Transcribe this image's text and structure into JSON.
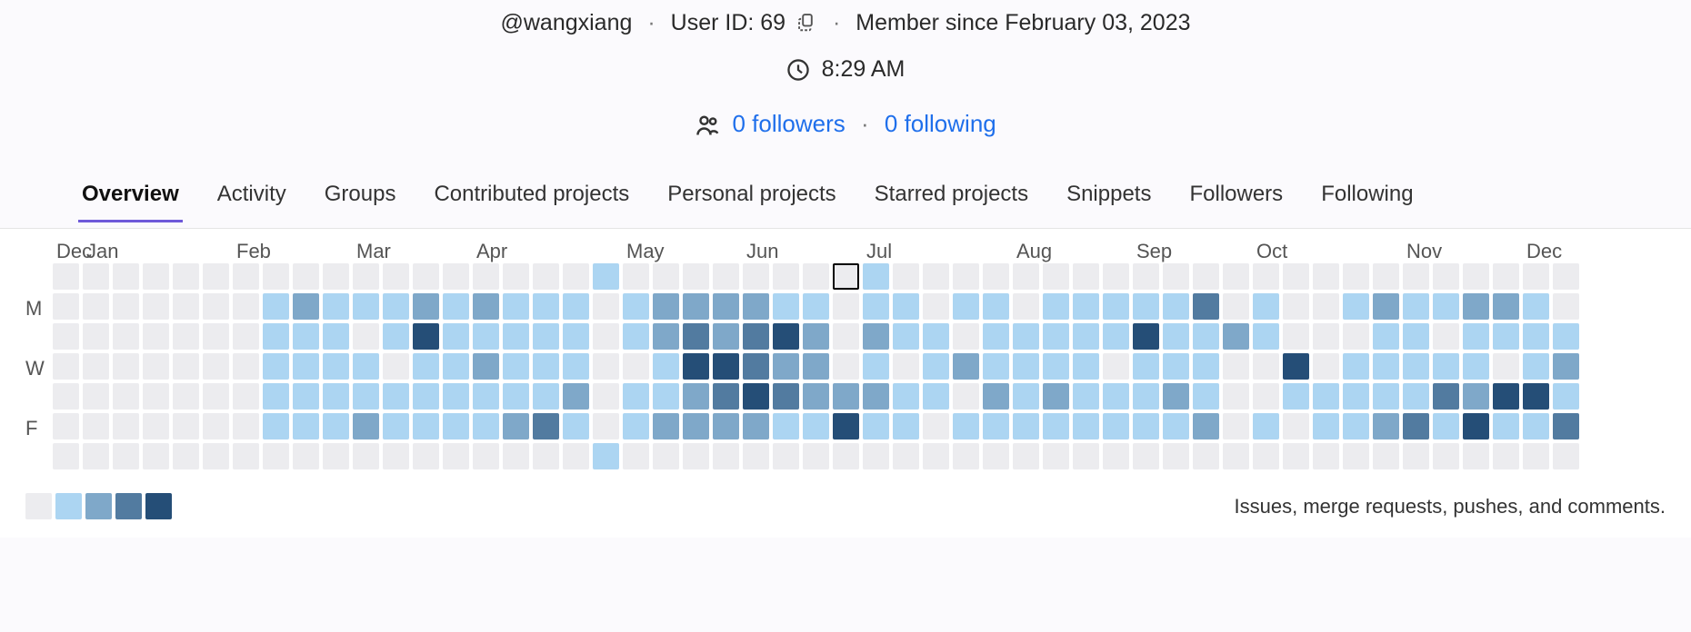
{
  "profile": {
    "handle": "@wangxiang",
    "user_id_label": "User ID: 69",
    "member_since": "Member since February 03, 2023",
    "local_time": "8:29 AM",
    "followers_label": "0 followers",
    "following_label": "0 following"
  },
  "tabs": [
    {
      "label": "Overview",
      "active": true
    },
    {
      "label": "Activity",
      "active": false
    },
    {
      "label": "Groups",
      "active": false
    },
    {
      "label": "Contributed projects",
      "active": false
    },
    {
      "label": "Personal projects",
      "active": false
    },
    {
      "label": "Starred projects",
      "active": false
    },
    {
      "label": "Snippets",
      "active": false
    },
    {
      "label": "Followers",
      "active": false
    },
    {
      "label": "Following",
      "active": false
    }
  ],
  "calendar": {
    "months": [
      {
        "label": "Dec",
        "span": 1
      },
      {
        "label": "Jan",
        "span": 5
      },
      {
        "label": "Feb",
        "span": 4
      },
      {
        "label": "Mar",
        "span": 4
      },
      {
        "label": "Apr",
        "span": 5
      },
      {
        "label": "May",
        "span": 4
      },
      {
        "label": "Jun",
        "span": 4
      },
      {
        "label": "Jul",
        "span": 5
      },
      {
        "label": "Aug",
        "span": 4
      },
      {
        "label": "Sep",
        "span": 4
      },
      {
        "label": "Oct",
        "span": 5
      },
      {
        "label": "Nov",
        "span": 4
      },
      {
        "label": "Dec",
        "span": 4
      }
    ],
    "day_labels": [
      "",
      "M",
      "",
      "W",
      "",
      "F",
      ""
    ],
    "legend_levels": [
      0,
      1,
      2,
      3,
      4
    ],
    "footnote": "Issues, merge requests, pushes, and comments.",
    "highlight": {
      "week": 26,
      "day": 0
    },
    "weeks": [
      [
        0,
        0,
        0,
        0,
        0,
        0,
        0
      ],
      [
        0,
        0,
        0,
        0,
        0,
        0,
        0
      ],
      [
        0,
        0,
        0,
        0,
        0,
        0,
        0
      ],
      [
        0,
        0,
        0,
        0,
        0,
        0,
        0
      ],
      [
        0,
        0,
        0,
        0,
        0,
        0,
        0
      ],
      [
        0,
        0,
        0,
        0,
        0,
        0,
        0
      ],
      [
        0,
        0,
        0,
        0,
        0,
        0,
        0
      ],
      [
        0,
        1,
        1,
        1,
        1,
        1,
        0
      ],
      [
        0,
        2,
        1,
        1,
        1,
        1,
        0
      ],
      [
        0,
        1,
        1,
        1,
        1,
        1,
        0
      ],
      [
        0,
        1,
        0,
        1,
        1,
        2,
        0
      ],
      [
        0,
        1,
        1,
        0,
        1,
        1,
        0
      ],
      [
        0,
        2,
        4,
        1,
        1,
        1,
        0
      ],
      [
        0,
        1,
        1,
        1,
        1,
        1,
        0
      ],
      [
        0,
        2,
        1,
        2,
        1,
        1,
        0
      ],
      [
        0,
        1,
        1,
        1,
        1,
        2,
        0
      ],
      [
        0,
        1,
        1,
        1,
        1,
        3,
        0
      ],
      [
        0,
        1,
        1,
        1,
        2,
        1,
        0
      ],
      [
        1,
        0,
        0,
        0,
        0,
        0,
        1
      ],
      [
        0,
        1,
        1,
        0,
        1,
        1,
        0
      ],
      [
        0,
        2,
        2,
        1,
        1,
        2,
        0
      ],
      [
        0,
        2,
        3,
        4,
        2,
        2,
        0
      ],
      [
        0,
        2,
        2,
        4,
        3,
        2,
        0
      ],
      [
        0,
        2,
        3,
        3,
        4,
        2,
        0
      ],
      [
        0,
        1,
        4,
        2,
        3,
        1,
        0
      ],
      [
        0,
        1,
        2,
        2,
        2,
        1,
        0
      ],
      [
        0,
        0,
        0,
        0,
        2,
        4,
        0
      ],
      [
        1,
        1,
        2,
        1,
        2,
        1,
        0
      ],
      [
        0,
        1,
        1,
        0,
        1,
        1,
        0
      ],
      [
        0,
        0,
        1,
        1,
        1,
        0,
        0
      ],
      [
        0,
        1,
        0,
        2,
        0,
        1,
        0
      ],
      [
        0,
        1,
        1,
        1,
        2,
        1,
        0
      ],
      [
        0,
        0,
        1,
        1,
        1,
        1,
        0
      ],
      [
        0,
        1,
        1,
        1,
        2,
        1,
        0
      ],
      [
        0,
        1,
        1,
        1,
        1,
        1,
        0
      ],
      [
        0,
        1,
        1,
        0,
        1,
        1,
        0
      ],
      [
        0,
        1,
        4,
        1,
        1,
        1,
        0
      ],
      [
        0,
        1,
        1,
        1,
        2,
        1,
        0
      ],
      [
        0,
        3,
        1,
        1,
        1,
        2,
        0
      ],
      [
        0,
        0,
        2,
        0,
        0,
        0,
        0
      ],
      [
        0,
        1,
        1,
        0,
        0,
        1,
        0
      ],
      [
        0,
        0,
        0,
        4,
        1,
        0,
        0
      ],
      [
        0,
        0,
        0,
        0,
        1,
        1,
        0
      ],
      [
        0,
        1,
        0,
        1,
        1,
        1,
        0
      ],
      [
        0,
        2,
        1,
        1,
        1,
        2,
        0
      ],
      [
        0,
        1,
        1,
        1,
        1,
        3,
        0
      ],
      [
        0,
        1,
        0,
        1,
        3,
        1,
        0
      ],
      [
        0,
        2,
        1,
        1,
        2,
        4,
        0
      ],
      [
        0,
        2,
        1,
        0,
        4,
        1,
        0
      ],
      [
        0,
        1,
        1,
        1,
        4,
        1,
        0
      ],
      [
        0,
        0,
        1,
        2,
        1,
        3,
        0
      ],
      [
        -1,
        -1,
        -1,
        -1,
        -1,
        -1,
        -1
      ]
    ]
  }
}
